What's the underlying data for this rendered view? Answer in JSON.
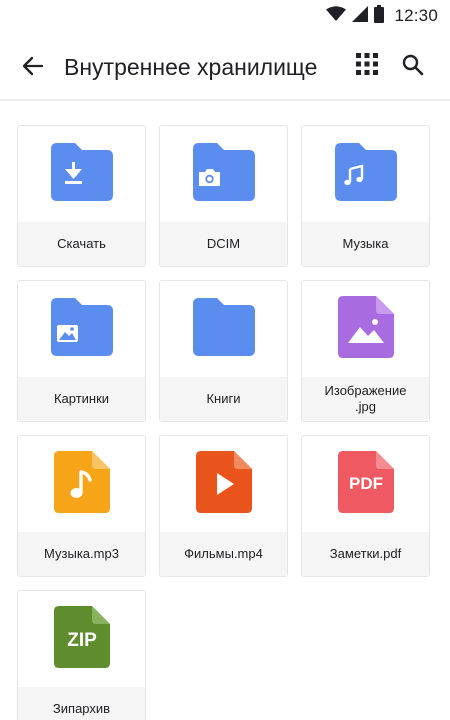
{
  "status_bar": {
    "time": "12:30",
    "icons": [
      "wifi-icon",
      "cell-signal-icon",
      "battery-icon"
    ]
  },
  "app_bar": {
    "title": "Внутреннее хранилище",
    "icons": [
      "back-arrow-icon",
      "grid-view-icon",
      "search-icon"
    ]
  },
  "colors": {
    "folder": "#5B8DEF",
    "image_file": "#A86BE0",
    "audio_file": "#F6A418",
    "video_file": "#E8541C",
    "pdf_file": "#EF5961",
    "zip_file": "#5E8C2E"
  },
  "items": [
    {
      "label": "Скачать",
      "icon": "download-folder-icon"
    },
    {
      "label": "DCIM",
      "icon": "camera-folder-icon"
    },
    {
      "label": "Музыка",
      "icon": "music-folder-icon"
    },
    {
      "label": "Картинки",
      "icon": "pictures-folder-icon"
    },
    {
      "label": "Книги",
      "icon": "folder-icon"
    },
    {
      "label": "Изображение\n.jpg",
      "icon": "image-file-icon"
    },
    {
      "label": "Музыка.mp3",
      "icon": "audio-file-icon"
    },
    {
      "label": "Фильмы.mp4",
      "icon": "video-file-icon"
    },
    {
      "label": "Заметки.pdf",
      "icon": "pdf-file-icon",
      "badge": "PDF"
    },
    {
      "label": "Зипархив",
      "icon": "zip-file-icon",
      "badge": "ZIP"
    }
  ]
}
